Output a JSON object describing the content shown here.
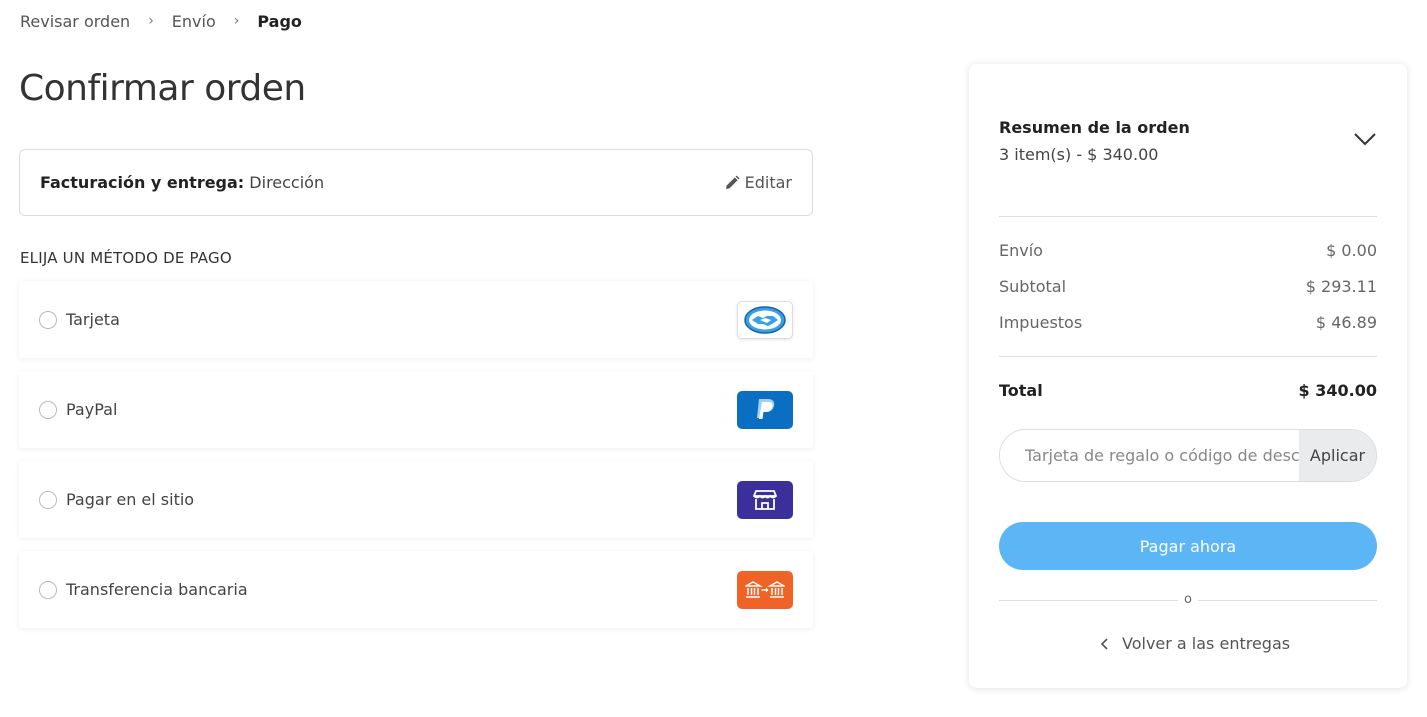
{
  "breadcrumb": {
    "items": [
      "Revisar orden",
      "Envío",
      "Pago"
    ],
    "separator": "›"
  },
  "page_title": "Confirmar orden",
  "billing": {
    "label": "Facturación y entrega:",
    "value": "Dirección",
    "edit_label": "Editar"
  },
  "payment_section_title": "ELIJA UN MÉTODO DE PAGO",
  "payment_methods": [
    {
      "label": "Tarjeta",
      "icon": "mercadopago-handshake-icon",
      "color": "#ffffff"
    },
    {
      "label": "PayPal",
      "icon": "paypal-icon",
      "color": "#0a6fc2"
    },
    {
      "label": "Pagar en el sitio",
      "icon": "store-icon",
      "color": "#3b2f9c"
    },
    {
      "label": "Transferencia bancaria",
      "icon": "bank-transfer-icon",
      "color": "#ef6327"
    }
  ],
  "summary": {
    "title": "Resumen de la orden",
    "subtitle": "3 item(s) -  $ 340.00",
    "rows": [
      {
        "label": "Envío",
        "value": "$ 0.00"
      },
      {
        "label": "Subtotal",
        "value": "$ 293.11"
      },
      {
        "label": "Impuestos",
        "value": "$ 46.89"
      }
    ],
    "total_label": "Total",
    "total_value": "$ 340.00",
    "coupon_placeholder": "Tarjeta de regalo o código de descuento",
    "apply_label": "Aplicar",
    "pay_label": "Pagar ahora",
    "or_label": "o",
    "back_label": "Volver a las entregas"
  },
  "colors": {
    "pay_button": "#5cb6f5",
    "paypal": "#0a6fc2",
    "store": "#3b2f9c",
    "bank": "#ef6327"
  }
}
